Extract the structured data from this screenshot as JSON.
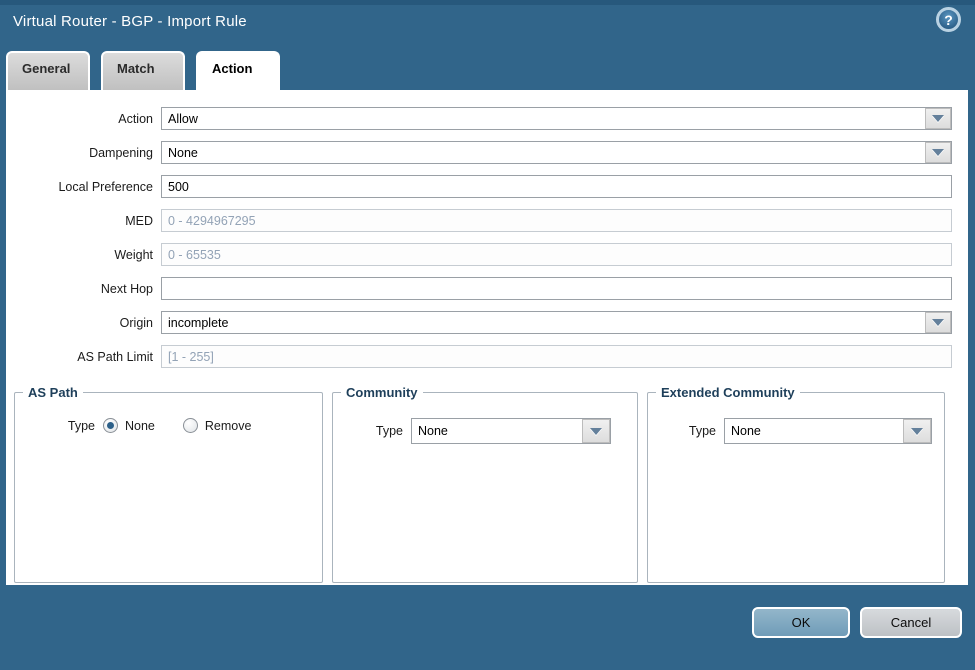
{
  "dialog": {
    "title": "Virtual Router - BGP - Import Rule",
    "help_glyph": "?"
  },
  "tabs": [
    {
      "label": "General",
      "active": false
    },
    {
      "label": "Match",
      "active": false
    },
    {
      "label": "Action",
      "active": true
    }
  ],
  "form": {
    "action": {
      "label": "Action",
      "value": "Allow",
      "type": "dropdown"
    },
    "dampening": {
      "label": "Dampening",
      "value": "None",
      "type": "dropdown"
    },
    "local_preference": {
      "label": "Local Preference",
      "value": "500",
      "type": "text"
    },
    "med": {
      "label": "MED",
      "placeholder": "0 - 4294967295",
      "disabled": true
    },
    "weight": {
      "label": "Weight",
      "placeholder": "0 - 65535",
      "disabled": true
    },
    "next_hop": {
      "label": "Next Hop",
      "value": "",
      "type": "text"
    },
    "origin": {
      "label": "Origin",
      "value": "incomplete",
      "type": "dropdown"
    },
    "as_path_limit": {
      "label": "AS Path Limit",
      "placeholder": "[1 - 255]",
      "disabled": true
    }
  },
  "sections": {
    "as_path": {
      "legend": "AS Path",
      "type_label": "Type",
      "options": [
        {
          "label": "None",
          "selected": true
        },
        {
          "label": "Remove",
          "selected": false
        }
      ]
    },
    "community": {
      "legend": "Community",
      "type_label": "Type",
      "value": "None"
    },
    "extended_community": {
      "legend": "Extended Community",
      "type_label": "Type",
      "value": "None"
    }
  },
  "buttons": {
    "ok": "OK",
    "cancel": "Cancel"
  },
  "colors": {
    "frame": "#31658a",
    "titlebar_top": "#27587c",
    "ok_button": "#7ea9c2",
    "cancel_button": "#c9cdd1",
    "legend_text": "#1e3f5a",
    "dropdown_arrow": "#64809b",
    "placeholder_text": "#93a3b6"
  }
}
